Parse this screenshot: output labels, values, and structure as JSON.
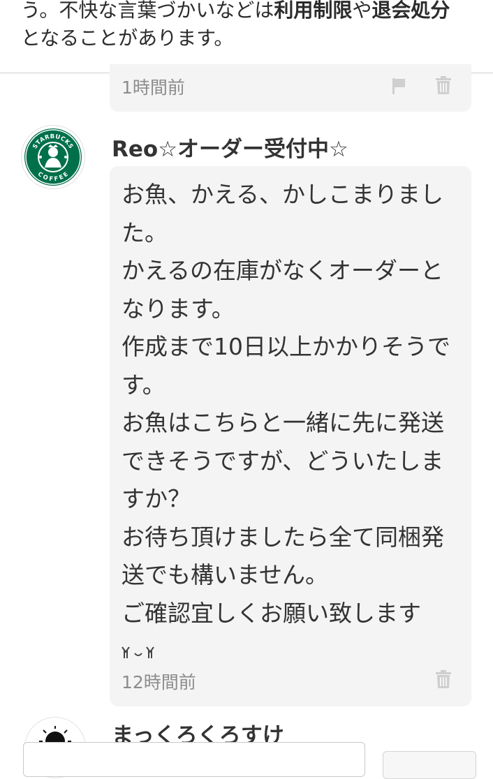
{
  "notice": {
    "line1_part1": "う。不快な言葉づかいなどは",
    "line1_bold1": "利用制限",
    "line1_part2": "や",
    "line1_bold2": "退会処分",
    "line2": "となることがあります。"
  },
  "previous_comment": {
    "timestamp": "1時間前",
    "icons": [
      "flag-icon",
      "trash-icon"
    ]
  },
  "comment": {
    "user_name": "Reo☆オーダー受付中☆",
    "avatar_text_top": "STARBUCKS",
    "avatar_text_bottom": "COFFEE",
    "message": "お魚、かえる、かしこまりました。\nかえるの在庫がなくオーダーとなります。\n作成まで10日以上かかりそうです。\nお魚はこちらと一緒に先に発送できそうですが、どういたしますか？\nお待ち頂けましたら全て同梱発送でも構いません。\nご確認宜しくお願い致します",
    "timestamp": "12時間前",
    "icons": [
      "emoticon-icon",
      "trash-icon"
    ]
  },
  "next_comment": {
    "user_name": "まっくろくろすけ"
  },
  "colors": {
    "bubble_bg": "#f4f4f4",
    "timestamp": "#8c8c8c",
    "icon_gray": "#cfcfcf",
    "starbucks_green": "#00704a"
  }
}
